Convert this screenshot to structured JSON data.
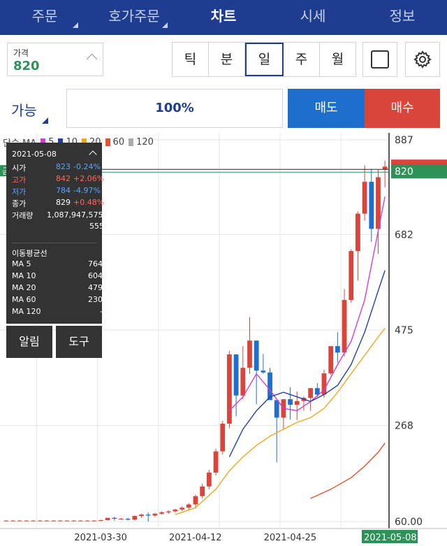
{
  "nav": {
    "tabs": [
      "주문",
      "호가주문",
      "차트",
      "시세",
      "정보"
    ]
  },
  "price": {
    "label": "가격",
    "value": "820"
  },
  "period": [
    "틱",
    "분",
    "일",
    "주",
    "월"
  ],
  "order": {
    "available_label": "가능",
    "quantity": "100%",
    "sell": "매도",
    "buy": "매수"
  },
  "chart": {
    "legend": {
      "prefix": "단순 MA",
      "periods": [
        "5",
        "10",
        "20",
        "60",
        "120"
      ],
      "colors": [
        "#d63bd6",
        "#1f3fb0",
        "#f2a81d",
        "#e8512a",
        "#aaaaaa"
      ]
    },
    "y_labels": [
      "887",
      "682",
      "475",
      "268",
      "60.00"
    ],
    "price_tag": "820",
    "x_labels": [
      "2021-03-30",
      "2021-04-12",
      "2021-04-25",
      "2021-05-08"
    ],
    "name_tag": "금 균"
  },
  "info": {
    "date": "2021-05-08",
    "open": {
      "label": "시가",
      "value": "823",
      "pct": "-0.24%"
    },
    "high": {
      "label": "고가",
      "value": "842",
      "pct": "+2.06%"
    },
    "low": {
      "label": "저가",
      "value": "784",
      "pct": "-4.97%"
    },
    "close": {
      "label": "종가",
      "value": "829",
      "pct": "+0.48%"
    },
    "volume": {
      "label": "거래량",
      "line1": "1,087,947,575.",
      "line2": "555"
    },
    "ma_title": "이동평균선",
    "ma": [
      {
        "label": "MA 5",
        "value": "764"
      },
      {
        "label": "MA 10",
        "value": "604"
      },
      {
        "label": "MA 20",
        "value": "479"
      },
      {
        "label": "MA 60",
        "value": "230"
      },
      {
        "label": "MA 120",
        "value": "-"
      }
    ],
    "alarm": "알림",
    "tools": "도구"
  },
  "chart_data": {
    "type": "candlestick",
    "candles": [
      {
        "o": 62,
        "h": 63,
        "l": 61,
        "c": 62
      },
      {
        "o": 62,
        "h": 63,
        "l": 61,
        "c": 62
      },
      {
        "o": 62,
        "h": 63,
        "l": 61,
        "c": 62
      },
      {
        "o": 62,
        "h": 63,
        "l": 61,
        "c": 62
      },
      {
        "o": 62,
        "h": 63,
        "l": 61,
        "c": 62
      },
      {
        "o": 62,
        "h": 63,
        "l": 61,
        "c": 62
      },
      {
        "o": 62,
        "h": 63,
        "l": 61,
        "c": 62
      },
      {
        "o": 62,
        "h": 63,
        "l": 61,
        "c": 62
      },
      {
        "o": 62,
        "h": 63,
        "l": 61,
        "c": 62
      },
      {
        "o": 62,
        "h": 63,
        "l": 61,
        "c": 62
      },
      {
        "o": 62,
        "h": 63,
        "l": 61,
        "c": 62
      },
      {
        "o": 62,
        "h": 63,
        "l": 61,
        "c": 62
      },
      {
        "o": 62,
        "h": 63,
        "l": 61,
        "c": 62
      },
      {
        "o": 62,
        "h": 63,
        "l": 61,
        "c": 62
      },
      {
        "o": 62,
        "h": 64,
        "l": 61,
        "c": 63
      },
      {
        "o": 63,
        "h": 66,
        "l": 62,
        "c": 68
      },
      {
        "o": 68,
        "h": 70,
        "l": 62,
        "c": 66
      },
      {
        "o": 66,
        "h": 68,
        "l": 64,
        "c": 66
      },
      {
        "o": 66,
        "h": 68,
        "l": 62,
        "c": 64
      },
      {
        "o": 64,
        "h": 73,
        "l": 62,
        "c": 72
      },
      {
        "o": 72,
        "h": 77,
        "l": 68,
        "c": 75
      },
      {
        "o": 75,
        "h": 80,
        "l": 60,
        "c": 73
      },
      {
        "o": 73,
        "h": 78,
        "l": 70,
        "c": 77
      },
      {
        "o": 77,
        "h": 82,
        "l": 75,
        "c": 80
      },
      {
        "o": 80,
        "h": 84,
        "l": 77,
        "c": 82
      },
      {
        "o": 82,
        "h": 88,
        "l": 79,
        "c": 86
      },
      {
        "o": 86,
        "h": 93,
        "l": 83,
        "c": 90
      },
      {
        "o": 90,
        "h": 100,
        "l": 86,
        "c": 97
      },
      {
        "o": 97,
        "h": 118,
        "l": 92,
        "c": 115
      },
      {
        "o": 115,
        "h": 142,
        "l": 110,
        "c": 136
      },
      {
        "o": 136,
        "h": 172,
        "l": 130,
        "c": 166
      },
      {
        "o": 166,
        "h": 218,
        "l": 160,
        "c": 212
      },
      {
        "o": 212,
        "h": 278,
        "l": 205,
        "c": 272
      },
      {
        "o": 272,
        "h": 430,
        "l": 262,
        "c": 422
      },
      {
        "o": 422,
        "h": 423,
        "l": 288,
        "c": 333
      },
      {
        "o": 333,
        "h": 440,
        "l": 325,
        "c": 393
      },
      {
        "o": 393,
        "h": 503,
        "l": 380,
        "c": 452
      },
      {
        "o": 452,
        "h": 452,
        "l": 314,
        "c": 387
      },
      {
        "o": 387,
        "h": 423,
        "l": 380,
        "c": 383
      },
      {
        "o": 383,
        "h": 393,
        "l": 325,
        "c": 323
      },
      {
        "o": 323,
        "h": 323,
        "l": 188,
        "c": 285
      },
      {
        "o": 285,
        "h": 303,
        "l": 260,
        "c": 325
      },
      {
        "o": 325,
        "h": 351,
        "l": 281,
        "c": 313
      },
      {
        "o": 313,
        "h": 342,
        "l": 280,
        "c": 321
      },
      {
        "o": 321,
        "h": 331,
        "l": 300,
        "c": 328
      },
      {
        "o": 328,
        "h": 349,
        "l": 300,
        "c": 349
      },
      {
        "o": 349,
        "h": 360,
        "l": 330,
        "c": 335
      },
      {
        "o": 335,
        "h": 389,
        "l": 328,
        "c": 381
      },
      {
        "o": 381,
        "h": 440,
        "l": 378,
        "c": 440
      },
      {
        "o": 440,
        "h": 470,
        "l": 404,
        "c": 426
      },
      {
        "o": 426,
        "h": 564,
        "l": 418,
        "c": 540
      },
      {
        "o": 540,
        "h": 650,
        "l": 534,
        "c": 646
      },
      {
        "o": 646,
        "h": 732,
        "l": 582,
        "c": 727
      },
      {
        "o": 727,
        "h": 832,
        "l": 712,
        "c": 796
      },
      {
        "o": 796,
        "h": 823,
        "l": 666,
        "c": 694
      },
      {
        "o": 694,
        "h": 822,
        "l": 640,
        "c": 806
      },
      {
        "o": 823,
        "h": 842,
        "l": 784,
        "c": 829
      }
    ],
    "ma": {
      "ma5": [
        [
          33,
          300
        ],
        [
          35,
          330
        ],
        [
          37,
          380
        ],
        [
          39,
          345
        ],
        [
          41,
          305
        ],
        [
          43,
          300
        ],
        [
          45,
          320
        ],
        [
          47,
          345
        ],
        [
          49,
          400
        ],
        [
          51,
          450
        ],
        [
          53,
          540
        ],
        [
          55,
          690
        ],
        [
          56,
          764
        ]
      ],
      "ma10": [
        [
          33,
          200
        ],
        [
          35,
          260
        ],
        [
          37,
          300
        ],
        [
          39,
          330
        ],
        [
          41,
          340
        ],
        [
          43,
          330
        ],
        [
          45,
          320
        ],
        [
          47,
          335
        ],
        [
          49,
          355
        ],
        [
          51,
          400
        ],
        [
          53,
          470
        ],
        [
          55,
          560
        ],
        [
          56,
          604
        ]
      ],
      "ma20": [
        [
          25,
          75
        ],
        [
          28,
          90
        ],
        [
          31,
          130
        ],
        [
          33,
          170
        ],
        [
          35,
          200
        ],
        [
          37,
          225
        ],
        [
          39,
          245
        ],
        [
          41,
          260
        ],
        [
          43,
          275
        ],
        [
          45,
          285
        ],
        [
          47,
          305
        ],
        [
          49,
          340
        ],
        [
          51,
          380
        ],
        [
          53,
          420
        ],
        [
          55,
          460
        ],
        [
          56,
          479
        ]
      ],
      "ma60": [
        [
          45,
          110
        ],
        [
          48,
          130
        ],
        [
          51,
          155
        ],
        [
          53,
          180
        ],
        [
          55,
          210
        ],
        [
          56,
          230
        ]
      ]
    },
    "y_ticks": [
      887,
      682,
      475,
      268,
      60
    ],
    "ylim": [
      60,
      887
    ],
    "x_ticks": [
      "2021-03-30",
      "2021-04-12",
      "2021-04-25",
      "2021-05-08"
    ]
  }
}
